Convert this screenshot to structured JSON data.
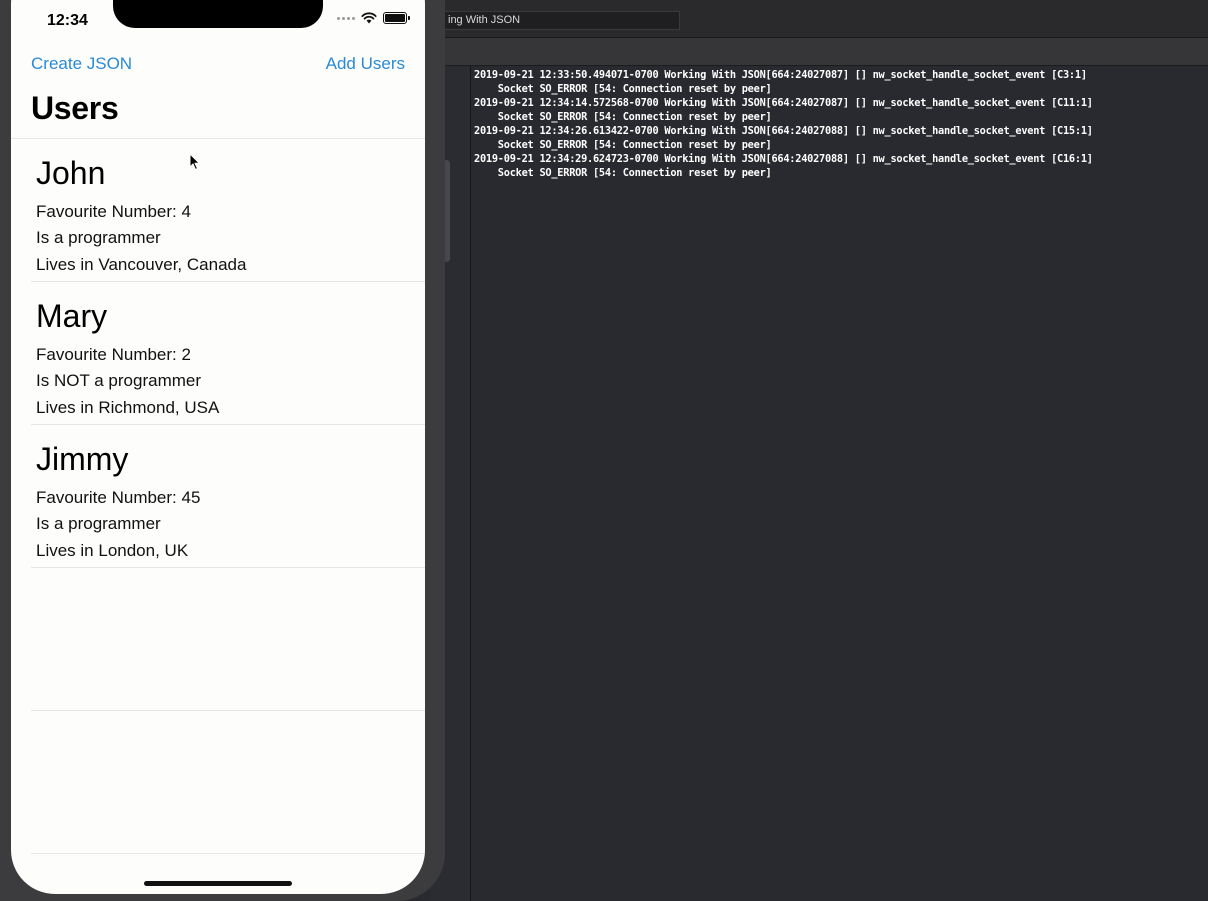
{
  "xcode": {
    "window_title": "ing With JSON",
    "console_lines": [
      "2019-09-21 12:33:50.494071-0700 Working With JSON[664:24027087] [] nw_socket_handle_socket_event [C3:1]",
      "    Socket SO_ERROR [54: Connection reset by peer]",
      "2019-09-21 12:34:14.572568-0700 Working With JSON[664:24027087] [] nw_socket_handle_socket_event [C11:1]",
      "    Socket SO_ERROR [54: Connection reset by peer]",
      "2019-09-21 12:34:26.613422-0700 Working With JSON[664:24027088] [] nw_socket_handle_socket_event [C15:1]",
      "    Socket SO_ERROR [54: Connection reset by peer]",
      "2019-09-21 12:34:29.624723-0700 Working With JSON[664:24027088] [] nw_socket_handle_socket_event [C16:1]",
      "    Socket SO_ERROR [54: Connection reset by peer]"
    ]
  },
  "phone": {
    "status": {
      "time": "12:34"
    },
    "nav": {
      "left_button": "Create JSON",
      "right_button": "Add Users",
      "title": "Users"
    },
    "users": [
      {
        "name": "John",
        "favourite": "Favourite Number: 4",
        "programmer": "Is a programmer",
        "location": "Lives in Vancouver, Canada"
      },
      {
        "name": "Mary",
        "favourite": "Favourite Number: 2",
        "programmer": "Is NOT a programmer",
        "location": "Lives in Richmond, USA"
      },
      {
        "name": "Jimmy",
        "favourite": "Favourite Number: 45",
        "programmer": "Is a programmer",
        "location": "Lives in London, UK"
      }
    ]
  },
  "icons": [
    "signal-icon",
    "wifi-icon",
    "battery-icon",
    "mouse-cursor-icon"
  ],
  "colors": {
    "accent": "#2a8ad6",
    "console_bg": "#292a30"
  }
}
